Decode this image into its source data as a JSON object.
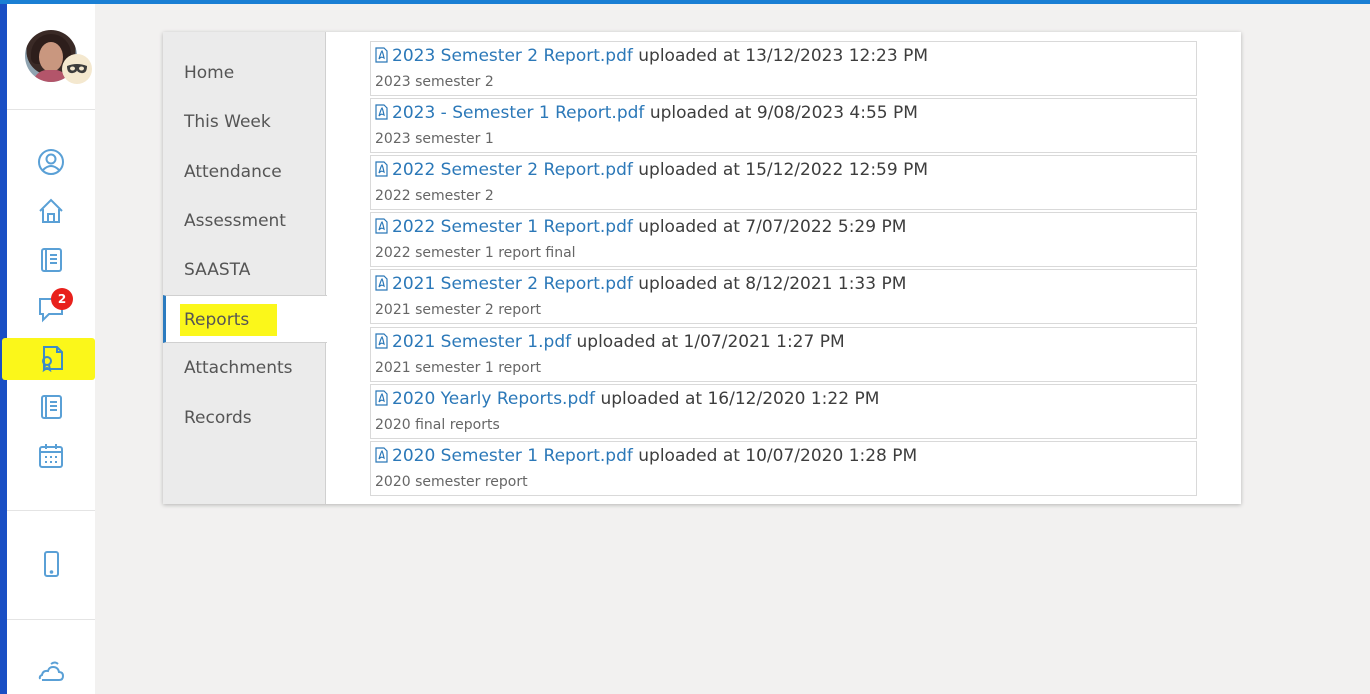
{
  "sidebar": {
    "badge_count": "2",
    "icons": [
      "profile-icon",
      "home-icon",
      "book-icon",
      "chat-icon",
      "reports-icon",
      "notebook-icon",
      "calendar-icon",
      "mobile-icon",
      "weather-icon"
    ],
    "highlight_color": "#fbf71a",
    "accent_color": "#1a7fd4"
  },
  "tabs": [
    {
      "label": "Home"
    },
    {
      "label": "This Week"
    },
    {
      "label": "Attendance"
    },
    {
      "label": "Assessment"
    },
    {
      "label": "SAASTA"
    },
    {
      "label": "Reports",
      "active": true
    },
    {
      "label": "Attachments"
    },
    {
      "label": "Records"
    }
  ],
  "reports": [
    {
      "file": "2023 Semester 2 Report.pdf",
      "uploaded": "uploaded at 13/12/2023 12:23 PM",
      "desc": "2023 semester 2"
    },
    {
      "file": "2023 - Semester 1 Report.pdf",
      "uploaded": "uploaded at 9/08/2023 4:55 PM",
      "desc": "2023 semester 1"
    },
    {
      "file": "2022 Semester 2 Report.pdf",
      "uploaded": "uploaded at 15/12/2022 12:59 PM",
      "desc": "2022 semester 2"
    },
    {
      "file": "2022 Semester 1 Report.pdf",
      "uploaded": "uploaded at 7/07/2022 5:29 PM",
      "desc": "2022 semester 1 report final"
    },
    {
      "file": "2021 Semester 2 Report.pdf",
      "uploaded": "uploaded at 8/12/2021 1:33 PM",
      "desc": "2021 semester 2 report"
    },
    {
      "file": "2021 Semester 1.pdf",
      "uploaded": "uploaded at 1/07/2021 1:27 PM",
      "desc": "2021 semester 1 report"
    },
    {
      "file": "2020 Yearly Reports.pdf",
      "uploaded": "uploaded at 16/12/2020 1:22 PM",
      "desc": "2020 final reports"
    },
    {
      "file": "2020 Semester 1 Report.pdf",
      "uploaded": "uploaded at 10/07/2020 1:28 PM",
      "desc": "2020 semester report"
    }
  ]
}
